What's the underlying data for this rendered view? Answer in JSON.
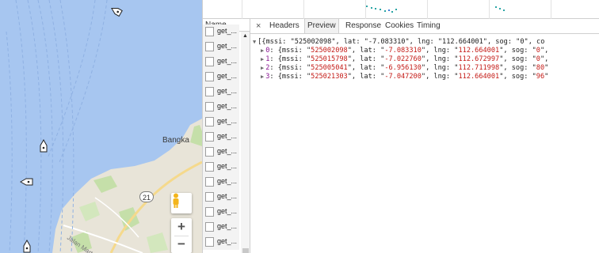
{
  "map": {
    "place_label": "Bangka",
    "street_label": "Jalan Martu...",
    "road_number": "21",
    "zoom_in_label": "+",
    "zoom_out_label": "−",
    "icons": [
      "boat-icon",
      "pegman-icon"
    ],
    "colors": {
      "water": "#a7c6f0",
      "land": "#e8e4d8",
      "vegetation": "#c5dfa9"
    }
  },
  "devtools": {
    "name_header": "Name",
    "requests": [
      "get_...",
      "get_...",
      "get_...",
      "get_...",
      "get_...",
      "get_...",
      "get_...",
      "get_...",
      "get_...",
      "get_...",
      "get_...",
      "get_...",
      "get_...",
      "get_...",
      "get_..."
    ],
    "tabs": {
      "close": "×",
      "headers": "Headers",
      "preview": "Preview",
      "response": "Response",
      "cookies": "Cookies",
      "timing": "Timing"
    },
    "preview": {
      "root": "[{mssi: \"525002098\", lat: \"-7.083310\", lng: \"112.664001\", sog: \"0\", co",
      "items": [
        {
          "idx": "0",
          "mssi": "525002098",
          "lat": "-7.083310",
          "lng": "112.664001",
          "sog": "0",
          "tail": "\","
        },
        {
          "idx": "1",
          "mssi": "525015798",
          "lat": "-7.022760",
          "lng": "112.672997",
          "sog": "0",
          "tail": "\","
        },
        {
          "idx": "2",
          "mssi": "525005041",
          "lat": "-6.956130",
          "lng": "112.711998",
          "sog": "80",
          "tail": "\""
        },
        {
          "idx": "3",
          "mssi": "525021303",
          "lat": "-7.047200",
          "lng": "112.664001",
          "sog": "96",
          "tail": "\""
        }
      ]
    },
    "colors": {
      "index": "#881391",
      "string": "#c41a16",
      "active_tab": "#f1f1f1"
    }
  }
}
